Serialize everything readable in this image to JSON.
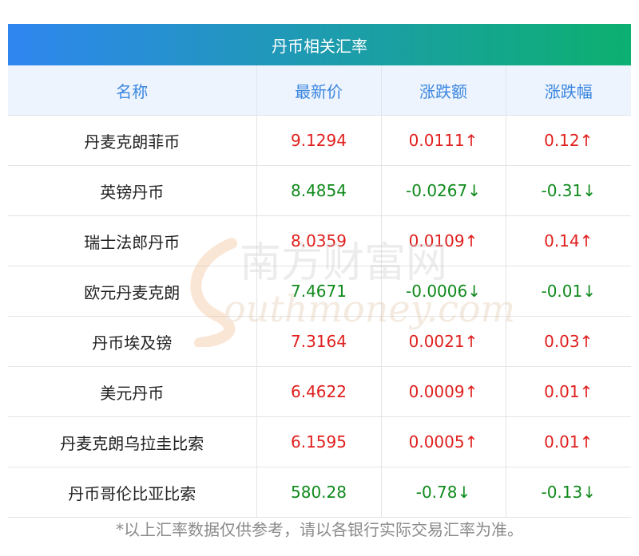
{
  "title": "丹币相关汇率",
  "headers": [
    "名称",
    "最新价",
    "涨跌额",
    "涨跌幅"
  ],
  "rows": [
    {
      "name": "丹麦克朗菲币",
      "price": "9.1294",
      "change": "0.0111↑",
      "pct": "0.12↑",
      "dir": "up"
    },
    {
      "name": "英镑丹币",
      "price": "8.4854",
      "change": "-0.0267↓",
      "pct": "-0.31↓",
      "dir": "down"
    },
    {
      "name": "瑞士法郎丹币",
      "price": "8.0359",
      "change": "0.0109↑",
      "pct": "0.14↑",
      "dir": "up"
    },
    {
      "name": "欧元丹麦克朗",
      "price": "7.4671",
      "change": "-0.0006↓",
      "pct": "-0.01↓",
      "dir": "down"
    },
    {
      "name": "丹币埃及镑",
      "price": "7.3164",
      "change": "0.0021↑",
      "pct": "0.03↑",
      "dir": "up"
    },
    {
      "name": "美元丹币",
      "price": "6.4622",
      "change": "0.0009↑",
      "pct": "0.01↑",
      "dir": "up"
    },
    {
      "name": "丹麦克朗乌拉圭比索",
      "price": "6.1595",
      "change": "0.0005↑",
      "pct": "0.01↑",
      "dir": "up"
    },
    {
      "name": "丹币哥伦比亚比索",
      "price": "580.28",
      "change": "-0.78↓",
      "pct": "-0.13↓",
      "dir": "down"
    }
  ],
  "note": "*以上汇率数据仅供参考，请以各银行实际交易汇率为准。",
  "watermark": {
    "cn": "南方财富网",
    "en": "outhmoney.com"
  },
  "colors": {
    "up": "#e0201e",
    "down": "#0f8a1c",
    "header_text": "#3a86e0"
  }
}
